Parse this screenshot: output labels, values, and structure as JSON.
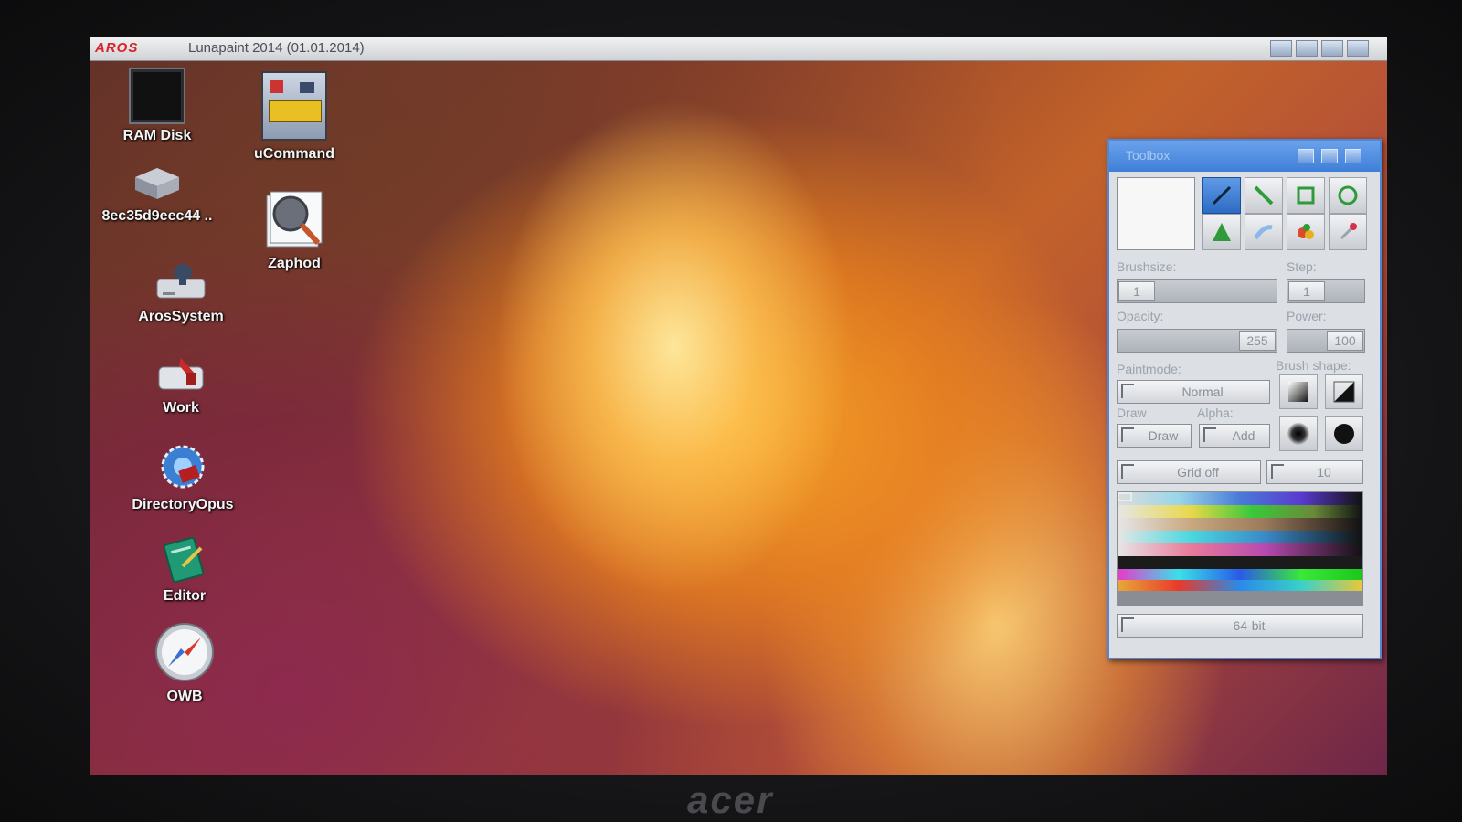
{
  "menubar": {
    "logo": "AROS",
    "title": "Lunapaint 2014 (01.01.2014)"
  },
  "desktop_icons": [
    {
      "label": "RAM Disk",
      "icon": "ram-disk-icon"
    },
    {
      "label": "8ec35d9eec44 ..",
      "icon": "hard-drive-icon"
    },
    {
      "label": "ArosSystem",
      "icon": "system-drive-icon"
    },
    {
      "label": "Work",
      "icon": "work-drive-icon"
    },
    {
      "label": "DirectoryOpus",
      "icon": "directory-opus-icon"
    },
    {
      "label": "Editor",
      "icon": "editor-icon"
    },
    {
      "label": "OWB",
      "icon": "compass-browser-icon"
    },
    {
      "label": "uCommand",
      "icon": "ucommand-icon"
    },
    {
      "label": "Zaphod",
      "icon": "zaphod-icon"
    }
  ],
  "toolbox": {
    "title": "Toolbox",
    "tools": [
      "brush-tool-icon",
      "line-tool-icon",
      "rectangle-tool-icon",
      "circle-tool-icon",
      "fill-tool-icon",
      "smudge-tool-icon",
      "colorize-tool-icon",
      "picker-tool-icon"
    ],
    "brushsize_label": "Brushsize:",
    "brushsize_value": "1",
    "step_label": "Step:",
    "step_value": "1",
    "opacity_label": "Opacity:",
    "opacity_value": "255",
    "power_label": "Power:",
    "power_value": "100",
    "paintmode_label": "Paintmode:",
    "paintmode_value": "Normal",
    "brush_shape_label": "Brush shape:",
    "draw_label": "Draw",
    "draw_value": "Draw",
    "alpha_label": "Alpha:",
    "alpha_value": "Add",
    "grid_value": "Grid off",
    "grid_size_value": "10",
    "color_depth_value": "64-bit"
  },
  "bezel": {
    "brand": "acer"
  },
  "colors": {
    "title_blue": "#3f7fd7",
    "panel_grey": "#dcdfe3",
    "logo_red": "#d9232a"
  }
}
